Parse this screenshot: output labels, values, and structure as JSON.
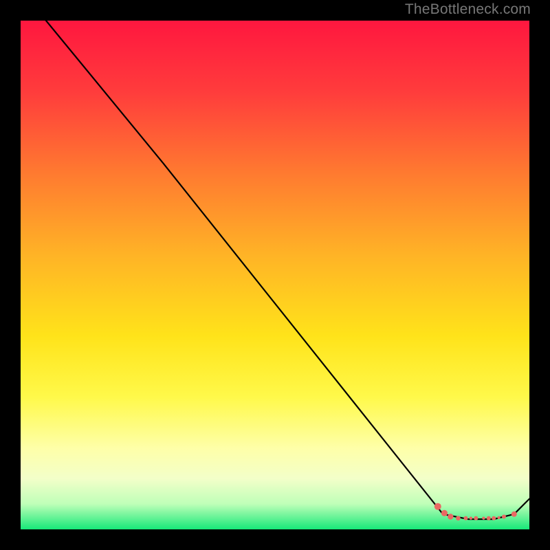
{
  "watermark": "TheBottleneck.com",
  "chart_data": {
    "type": "line",
    "title": "",
    "xlabel": "",
    "ylabel": "",
    "xlim": [
      0,
      100
    ],
    "ylim": [
      0,
      100
    ],
    "grid": false,
    "legend": false,
    "gradient_stops": [
      {
        "offset": 0,
        "color": "#ff173f"
      },
      {
        "offset": 14,
        "color": "#ff3c3c"
      },
      {
        "offset": 30,
        "color": "#ff7a30"
      },
      {
        "offset": 46,
        "color": "#ffb326"
      },
      {
        "offset": 62,
        "color": "#ffe31a"
      },
      {
        "offset": 74,
        "color": "#fff94a"
      },
      {
        "offset": 84,
        "color": "#feffa8"
      },
      {
        "offset": 90,
        "color": "#f3ffc9"
      },
      {
        "offset": 95,
        "color": "#bfffb8"
      },
      {
        "offset": 100,
        "color": "#17e879"
      }
    ],
    "series": [
      {
        "name": "bottleneck-curve",
        "color": "#000000",
        "x": [
          0,
          5,
          28,
          83,
          88,
          93,
          97,
          100
        ],
        "y": [
          105,
          100,
          72,
          3,
          2,
          2,
          3,
          6
        ]
      }
    ],
    "markers": {
      "name": "highlight-segment",
      "color": "#e96a63",
      "points": [
        {
          "x": 82,
          "y": 4.5,
          "r": 5
        },
        {
          "x": 83.3,
          "y": 3.2,
          "r": 4.6
        },
        {
          "x": 84.5,
          "y": 2.5,
          "r": 4.2
        },
        {
          "x": 86,
          "y": 2.2,
          "r": 3.4
        },
        {
          "x": 87.5,
          "y": 2.2,
          "r": 3.0
        },
        {
          "x": 88.5,
          "y": 2.2,
          "r": 2.2
        },
        {
          "x": 89.5,
          "y": 2.2,
          "r": 3.0
        },
        {
          "x": 91,
          "y": 2.2,
          "r": 2.2
        },
        {
          "x": 92,
          "y": 2.2,
          "r": 3.0
        },
        {
          "x": 93,
          "y": 2.2,
          "r": 3.0
        },
        {
          "x": 94,
          "y": 2.3,
          "r": 2.2
        },
        {
          "x": 95,
          "y": 2.5,
          "r": 3.0
        },
        {
          "x": 97,
          "y": 3.0,
          "r": 4.0
        }
      ]
    }
  }
}
